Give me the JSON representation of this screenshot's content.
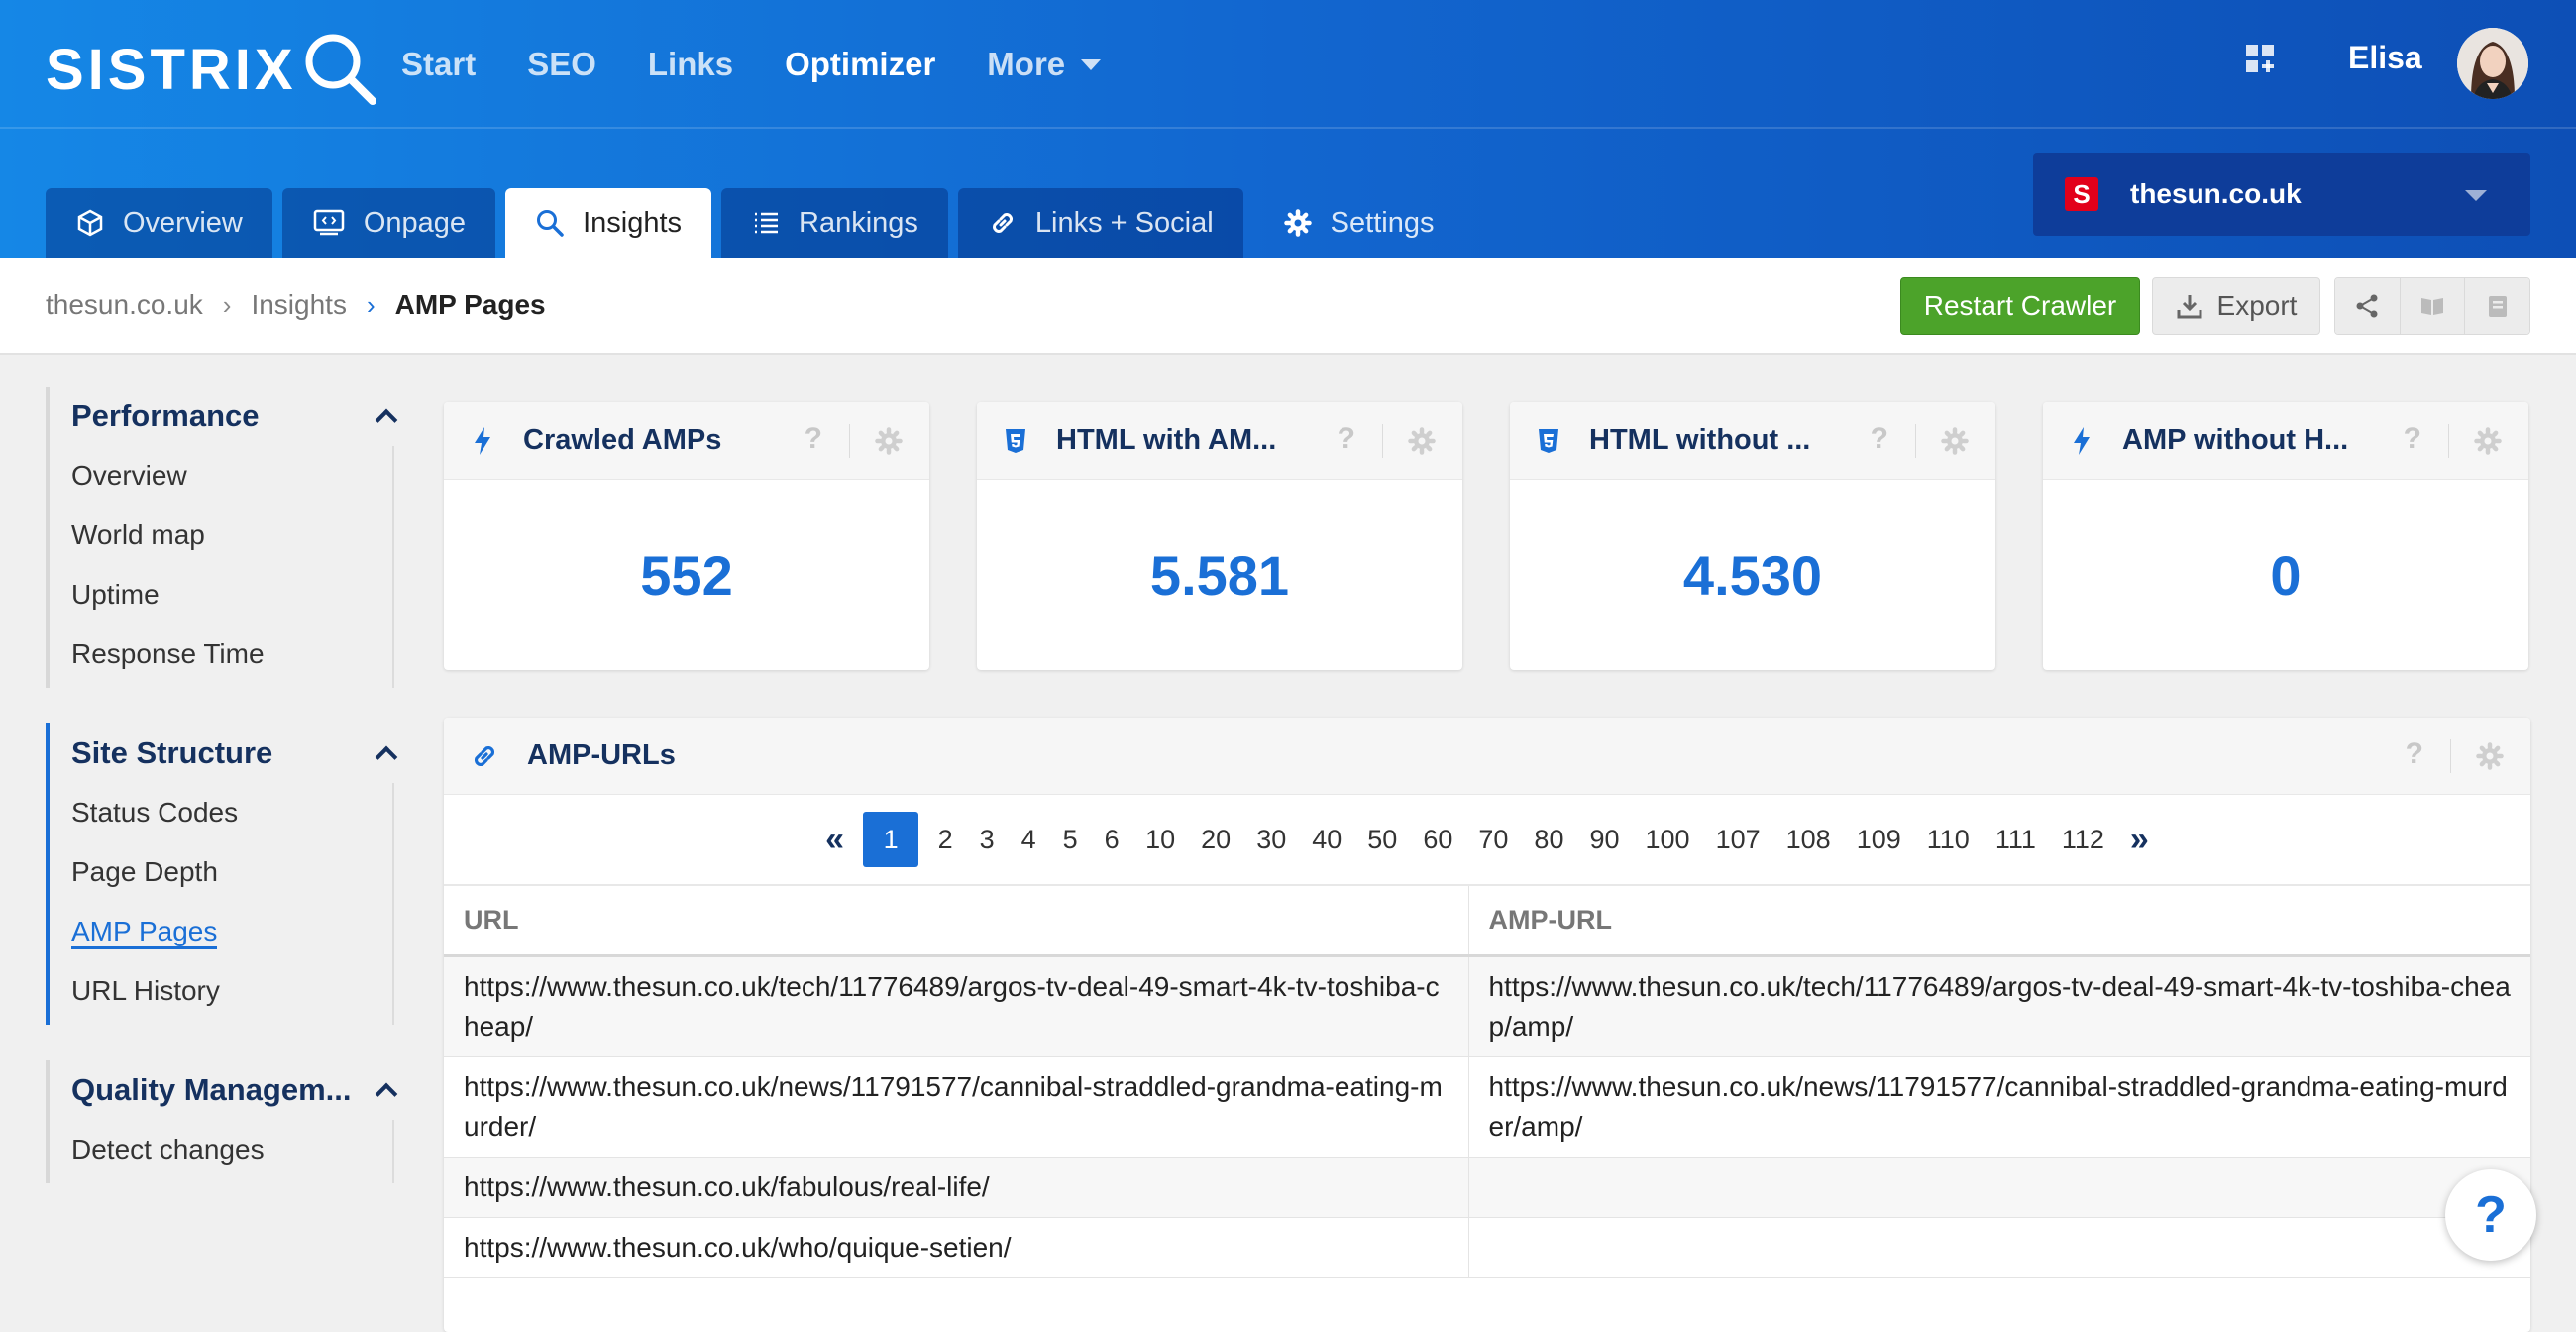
{
  "brand": {
    "logo_text": "SISTRIX"
  },
  "topnav": {
    "items": [
      "Start",
      "SEO",
      "Links",
      "Optimizer",
      "More"
    ]
  },
  "user": {
    "name": "Elisa"
  },
  "tabs": [
    "Overview",
    "Onpage",
    "Insights",
    "Rankings",
    "Links + Social",
    "Settings"
  ],
  "domain_select": {
    "flag": "S",
    "value": "thesun.co.uk"
  },
  "breadcrumb": {
    "items": [
      "thesun.co.uk",
      "Insights",
      "AMP Pages"
    ]
  },
  "toolbar": {
    "restart_label": "Restart Crawler",
    "export_label": "Export"
  },
  "sidebar": {
    "sections": [
      {
        "title": "Performance",
        "items": [
          "Overview",
          "World map",
          "Uptime",
          "Response Time"
        ]
      },
      {
        "title": "Site Structure",
        "items": [
          "Status Codes",
          "Page Depth",
          "AMP Pages",
          "URL History"
        ]
      },
      {
        "title": "Quality Managem...",
        "items": [
          "Detect changes"
        ]
      }
    ]
  },
  "kpis": [
    {
      "title": "Crawled AMPs",
      "value": "552",
      "icon": "bolt-icon"
    },
    {
      "title": "HTML with AM...",
      "value": "5.581",
      "icon": "html5-icon"
    },
    {
      "title": "HTML without ...",
      "value": "4.530",
      "icon": "html5-icon"
    },
    {
      "title": "AMP without H...",
      "value": "0",
      "icon": "bolt-icon"
    }
  ],
  "amp_urls": {
    "title": "AMP-URLs",
    "pages": [
      "1",
      "2",
      "3",
      "4",
      "5",
      "6",
      "10",
      "20",
      "30",
      "40",
      "50",
      "60",
      "70",
      "80",
      "90",
      "100",
      "107",
      "108",
      "109",
      "110",
      "111",
      "112"
    ],
    "columns": [
      "URL",
      "AMP-URL"
    ],
    "rows": [
      [
        "https://www.thesun.co.uk/tech/11776489/argos-tv-deal-49-smart-4k-tv-toshiba-cheap/",
        "https://www.thesun.co.uk/tech/11776489/argos-tv-deal-49-smart-4k-tv-toshiba-cheap/amp/"
      ],
      [
        "https://www.thesun.co.uk/news/11791577/cannibal-straddled-grandma-eating-murder/",
        "https://www.thesun.co.uk/news/11791577/cannibal-straddled-grandma-eating-murder/amp/"
      ],
      [
        "https://www.thesun.co.uk/fabulous/real-life/",
        ""
      ],
      [
        "https://www.thesun.co.uk/who/quique-setien/",
        ""
      ]
    ]
  },
  "common": {
    "help": "?"
  },
  "colors": {
    "accent": "#1a6fd6",
    "header_start": "#1587e6",
    "header_end": "#0d4fb6",
    "restart_green": "#4ca32a"
  }
}
